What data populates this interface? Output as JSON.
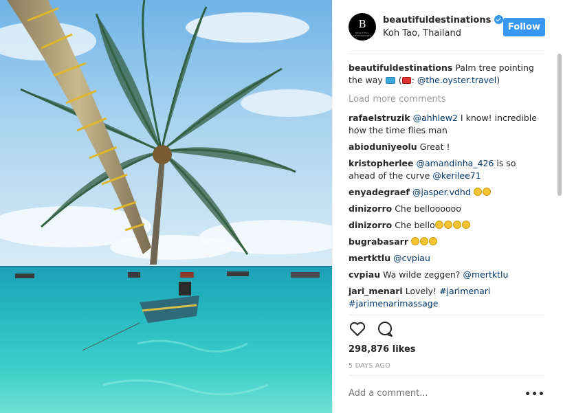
{
  "post": {
    "username": "beautifuldestinations",
    "location": "Koh Tao, Thailand",
    "follow_label": "Follow",
    "avatar_text": "B",
    "avatar_subtext": "BEAUTIFUL DESTINATIONS"
  },
  "caption": {
    "user": "beautifuldestinations",
    "text_before": "Palm tree pointing the way",
    "text_mid": "(",
    "text_mid2": ":",
    "mention": "@the.oyster.travel",
    "text_after": ")"
  },
  "load_more": "Load more comments",
  "comments": [
    {
      "user": "rafaelstruzik",
      "mention": "@ahhlew2",
      "text": "I know! incredible how the time flies man"
    },
    {
      "user": "abioduniyeolu",
      "text": "Great !"
    },
    {
      "user": "kristopherlee",
      "mention": "@amandinha_426",
      "text": "is so ahead of the curve",
      "mention2": "@kerilee71"
    },
    {
      "user": "enyadegraef",
      "mention": "@jasper.vdhd"
    },
    {
      "user": "dinizorro",
      "text": "Che belloooooo"
    },
    {
      "user": "dinizorro",
      "text": "Che bello"
    },
    {
      "user": "bugrabasarr"
    },
    {
      "user": "mertktlu",
      "mention": "@cvpiau"
    },
    {
      "user": "cvpiau",
      "text": "Wa wilde zeggen?",
      "mention": "@mertktlu"
    },
    {
      "user": "jari_menari",
      "text": "Lovely!",
      "mention": "#jarimenari",
      "mention2": "#jarimenarimassage"
    }
  ],
  "likes": "298,876 likes",
  "time": "5 DAYS AGO",
  "add_comment_placeholder": "Add a comment...",
  "more_label": "•••",
  "colors": {
    "accent": "#3897f0",
    "link": "#003569",
    "muted": "#999999"
  },
  "icons": [
    "heart-icon",
    "comment-icon",
    "verified-badge-icon",
    "more-options-icon"
  ]
}
